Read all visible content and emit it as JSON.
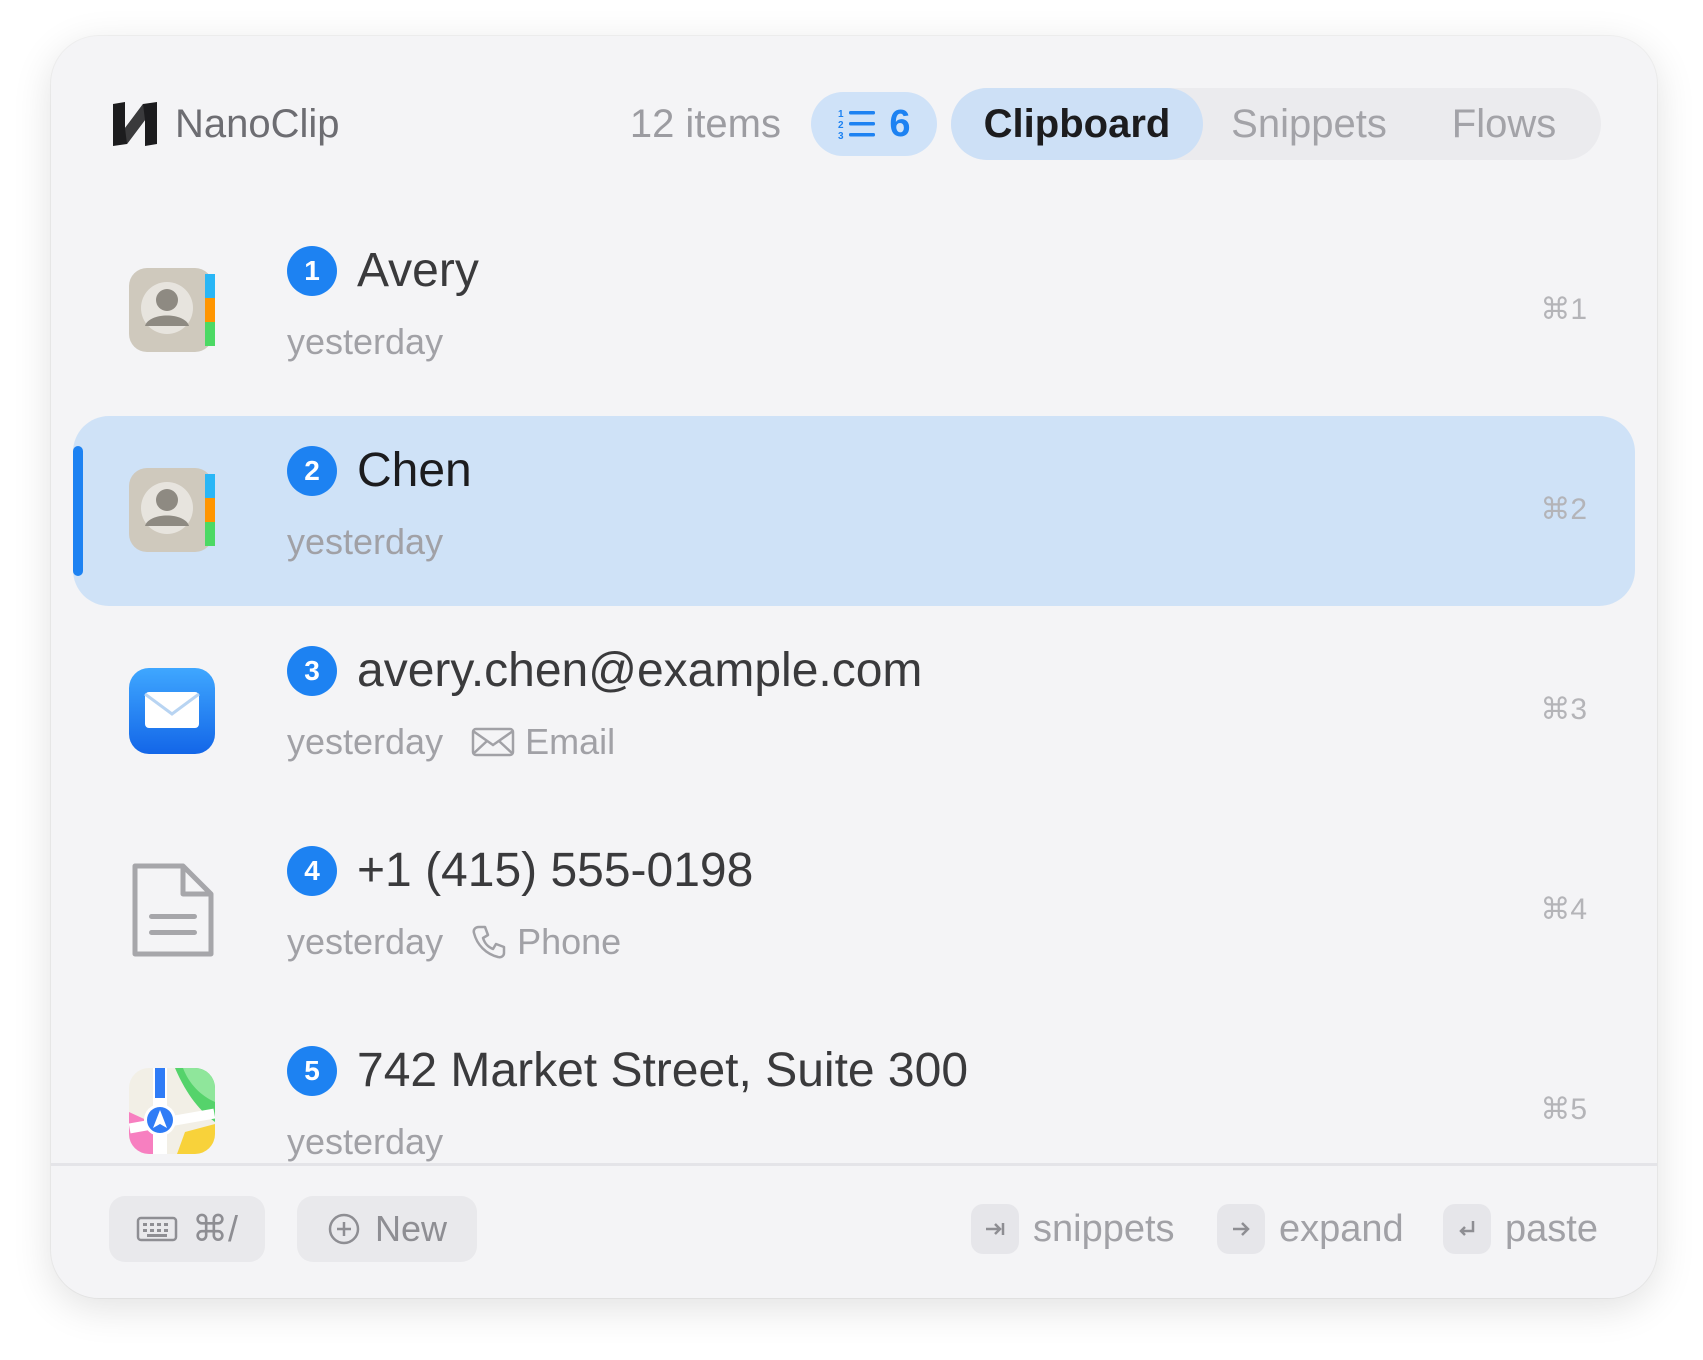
{
  "app": {
    "title": "NanoClip",
    "item_count": "12 items",
    "queue_count": "6"
  },
  "tabs": [
    {
      "label": "Clipboard",
      "active": true
    },
    {
      "label": "Snippets",
      "active": false
    },
    {
      "label": "Flows",
      "active": false
    }
  ],
  "items": [
    {
      "number": "1",
      "title": "Avery",
      "time": "yesterday",
      "type": "",
      "shortcut": "⌘1",
      "icon": "contacts-app-icon",
      "selected": false
    },
    {
      "number": "2",
      "title": "Chen",
      "time": "yesterday",
      "type": "",
      "shortcut": "⌘2",
      "icon": "contacts-app-icon",
      "selected": true
    },
    {
      "number": "3",
      "title": "avery.chen@example.com",
      "time": "yesterday",
      "type": "Email",
      "shortcut": "⌘3",
      "icon": "mail-app-icon",
      "selected": false
    },
    {
      "number": "4",
      "title": "+1 (415) 555-0198",
      "time": "yesterday",
      "type": "Phone",
      "shortcut": "⌘4",
      "icon": "document-icon",
      "selected": false
    },
    {
      "number": "5",
      "title": "742 Market Street, Suite 300",
      "time": "yesterday",
      "type": "",
      "shortcut": "⌘5",
      "icon": "maps-app-icon",
      "selected": false
    }
  ],
  "footer": {
    "keyboard_shortcut": "⌘/",
    "new_label": "New",
    "hint_snippets": "snippets",
    "hint_expand": "expand",
    "hint_paste": "paste"
  },
  "colors": {
    "accent": "#1d82f2",
    "selected_row": "#cfe2f7",
    "background": "#f4f4f6"
  }
}
